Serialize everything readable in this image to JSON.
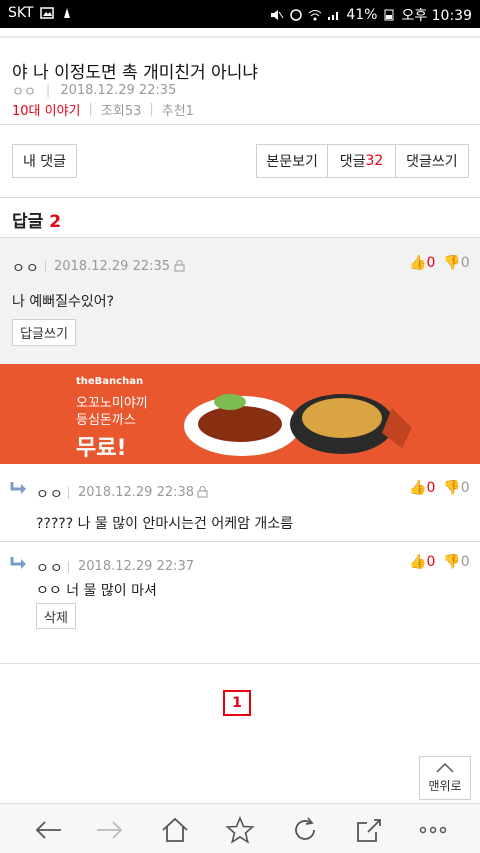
{
  "status_bar": {
    "carrier": "SKT",
    "battery": "41%",
    "time": "오후 10:39"
  },
  "post": {
    "title": "야 나 이정도면 촉 개미친거 아니냐",
    "author": "ㅇㅇ",
    "date": "2018.12.29 22:35",
    "category": "10대 이야기",
    "views": "조회53",
    "recommend": "추천1"
  },
  "buttons": {
    "my_comments": "내 댓글",
    "view_body": "본문보기",
    "comments_label": "댓글",
    "comments_count": "32",
    "write_comment": "댓글쓰기"
  },
  "replies": {
    "header_label": "답글",
    "header_count": "2"
  },
  "comments": [
    {
      "author": "ㅇㅇ",
      "date": "2018.12.29 22:35",
      "body": "나 예뻐질수있어?",
      "up": "0",
      "down": "0",
      "action": "답글쓰기"
    },
    {
      "author": "ㅇㅇ",
      "date": "2018.12.29 22:38",
      "body": "????? 나 물 많이 안마시는건 어케암 개소름",
      "up": "0",
      "down": "0"
    },
    {
      "author": "ㅇㅇ",
      "date": "2018.12.29 22:37",
      "body": "ㅇㅇ 너 물 많이 마셔",
      "up": "0",
      "down": "0",
      "action": "삭제"
    }
  ],
  "banner": {
    "brand": "theBanchan",
    "line1": "오꼬노미야끼",
    "line2": "등심돈까스",
    "line3": "무료!"
  },
  "pagination": {
    "current": "1"
  },
  "top_button": "맨위로"
}
